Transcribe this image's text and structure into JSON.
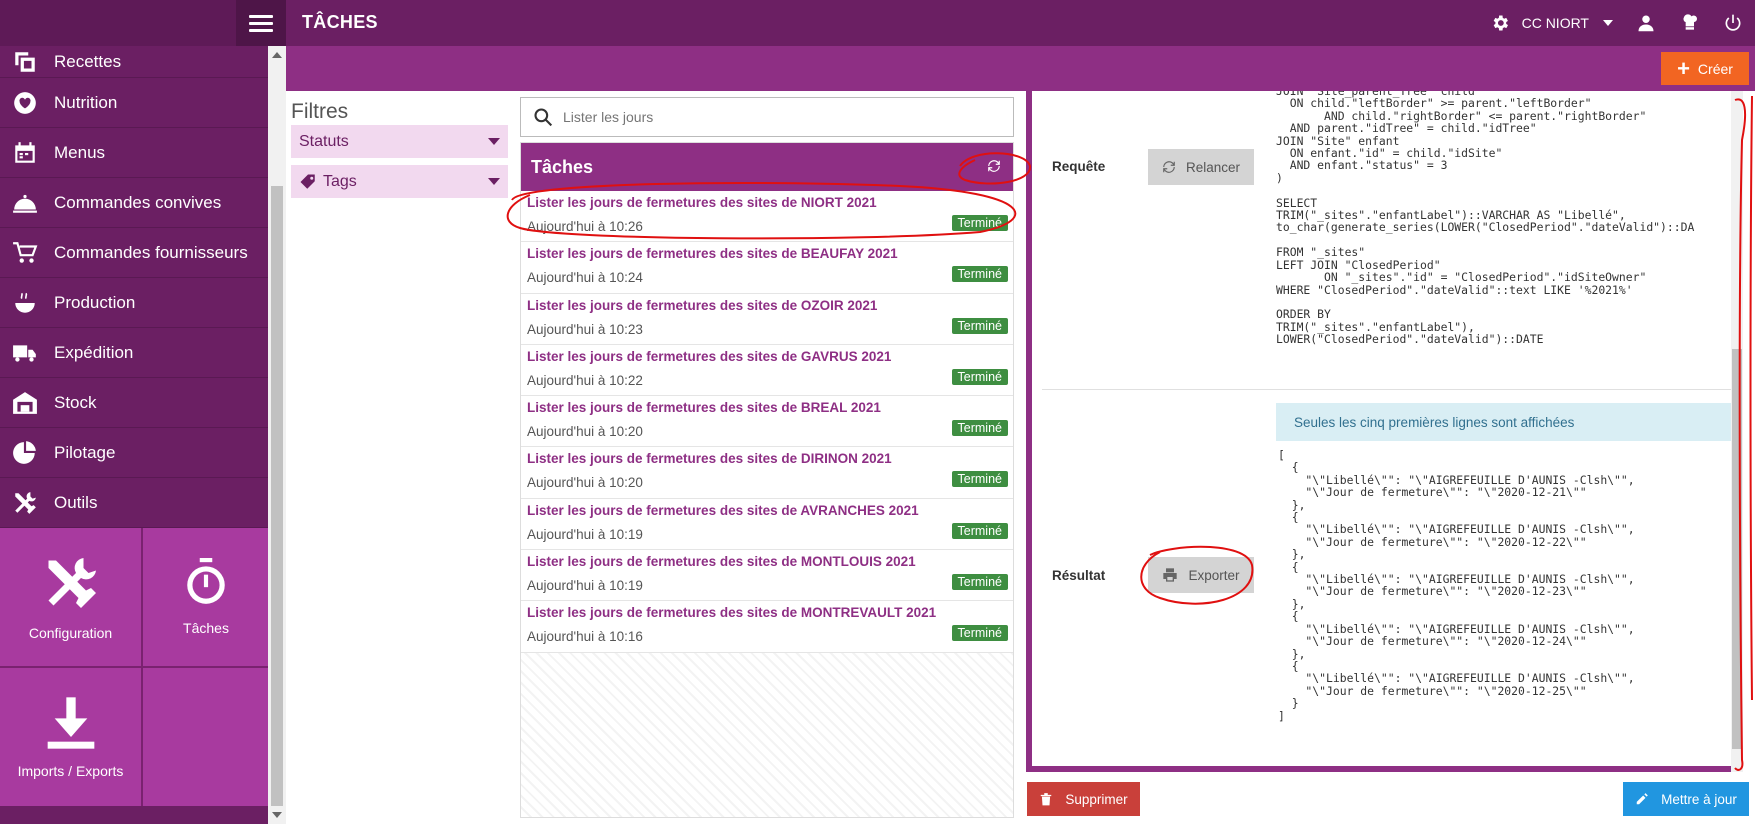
{
  "header": {
    "title": "TÂCHES",
    "site_selector": "CC NIORT"
  },
  "toolbar": {
    "create_label": "Créer"
  },
  "sidebar": {
    "items": [
      {
        "label": "Recettes",
        "icon": "recipes-icon"
      },
      {
        "label": "Nutrition",
        "icon": "nutrition-icon"
      },
      {
        "label": "Menus",
        "icon": "calendar-icon"
      },
      {
        "label": "Commandes convives",
        "icon": "cloche-icon"
      },
      {
        "label": "Commandes fournisseurs",
        "icon": "cart-icon"
      },
      {
        "label": "Production",
        "icon": "cooking-pot-icon"
      },
      {
        "label": "Expédition",
        "icon": "truck-icon"
      },
      {
        "label": "Stock",
        "icon": "warehouse-icon"
      },
      {
        "label": "Pilotage",
        "icon": "pie-chart-icon"
      },
      {
        "label": "Outils",
        "icon": "tools-icon"
      }
    ],
    "tiles": [
      {
        "label": "Configuration",
        "icon": "tools-icon"
      },
      {
        "label": "Tâches",
        "icon": "stopwatch-icon"
      },
      {
        "label": "Imports / Exports",
        "icon": "download-icon"
      }
    ]
  },
  "filters": {
    "title": "Filtres",
    "statuts": "Statuts",
    "tags": "Tags"
  },
  "search": {
    "placeholder": "Lister les jours"
  },
  "tasks": {
    "header": "Tâches",
    "rows": [
      {
        "title": "Lister les jours de fermetures des sites de NIORT 2021",
        "time": "Aujourd'hui à 10:26",
        "status": "Terminé"
      },
      {
        "title": "Lister les jours de fermetures des sites de BEAUFAY 2021",
        "time": "Aujourd'hui à 10:24",
        "status": "Terminé"
      },
      {
        "title": "Lister les jours de fermetures des sites de OZOIR 2021",
        "time": "Aujourd'hui à 10:23",
        "status": "Terminé"
      },
      {
        "title": "Lister les jours de fermetures des sites de GAVRUS 2021",
        "time": "Aujourd'hui à 10:22",
        "status": "Terminé"
      },
      {
        "title": "Lister les jours de fermetures des sites de BREAL 2021",
        "time": "Aujourd'hui à 10:20",
        "status": "Terminé"
      },
      {
        "title": "Lister les jours de fermetures des sites de DIRINON 2021",
        "time": "Aujourd'hui à 10:20",
        "status": "Terminé"
      },
      {
        "title": "Lister les jours de fermetures des sites de AVRANCHES 2021",
        "time": "Aujourd'hui à 10:19",
        "status": "Terminé"
      },
      {
        "title": "Lister les jours de fermetures des sites de MONTLOUIS 2021",
        "time": "Aujourd'hui à 10:19",
        "status": "Terminé"
      },
      {
        "title": "Lister les jours de fermetures des sites de MONTREVAULT 2021",
        "time": "Aujourd'hui à 10:16",
        "status": "Terminé"
      }
    ]
  },
  "detail": {
    "request_label": "Requête",
    "relaunch_label": "Relancer",
    "sql": "JOIN \"Site_parent_Tree\" child\n  ON child.\"leftBorder\" >= parent.\"leftBorder\"\n       AND child.\"rightBorder\" <= parent.\"rightBorder\"\n  AND parent.\"idTree\" = child.\"idTree\"\nJOIN \"Site\" enfant\n  ON enfant.\"id\" = child.\"idSite\"\n  AND enfant.\"status\" = 3\n)\n\nSELECT\nTRIM(\"_sites\".\"enfantLabel\")::VARCHAR AS \"Libellé\",\nto_char(generate_series(LOWER(\"ClosedPeriod\".\"dateValid\")::DA\n\nFROM \"_sites\"\nLEFT JOIN \"ClosedPeriod\"\n       ON \"_sites\".\"id\" = \"ClosedPeriod\".\"idSiteOwner\"\nWHERE \"ClosedPeriod\".\"dateValid\"::text LIKE '%2021%'\n\nORDER BY\nTRIM(\"_sites\".\"enfantLabel\"),\nLOWER(\"ClosedPeriod\".\"dateValid\")::DATE",
    "result_label": "Résultat",
    "export_label": "Exporter",
    "info": "Seules les cinq premières lignes sont affichées",
    "json": "[\n  {\n    \"\\\"Libellé\\\"\": \"\\\"AIGREFEUILLE D'AUNIS -Clsh\\\"\",\n    \"\\\"Jour de fermeture\\\"\": \"\\\"2020-12-21\\\"\"\n  },\n  {\n    \"\\\"Libellé\\\"\": \"\\\"AIGREFEUILLE D'AUNIS -Clsh\\\"\",\n    \"\\\"Jour de fermeture\\\"\": \"\\\"2020-12-22\\\"\"\n  },\n  {\n    \"\\\"Libellé\\\"\": \"\\\"AIGREFEUILLE D'AUNIS -Clsh\\\"\",\n    \"\\\"Jour de fermeture\\\"\": \"\\\"2020-12-23\\\"\"\n  },\n  {\n    \"\\\"Libellé\\\"\": \"\\\"AIGREFEUILLE D'AUNIS -Clsh\\\"\",\n    \"\\\"Jour de fermeture\\\"\": \"\\\"2020-12-24\\\"\"\n  },\n  {\n    \"\\\"Libellé\\\"\": \"\\\"AIGREFEUILLE D'AUNIS -Clsh\\\"\",\n    \"\\\"Jour de fermeture\\\"\": \"\\\"2020-12-25\\\"\"\n  }\n]"
  },
  "footer": {
    "delete_label": "Supprimer",
    "update_label": "Mettre à jour"
  },
  "colors": {
    "brand_purple": "#6b1f63",
    "toolbar_purple": "#8e2f84",
    "create_orange": "#f26522",
    "done_green": "#3e8e41",
    "delete_red": "#c9403a",
    "update_blue": "#2196e0",
    "annotation_red": "#e01010"
  }
}
